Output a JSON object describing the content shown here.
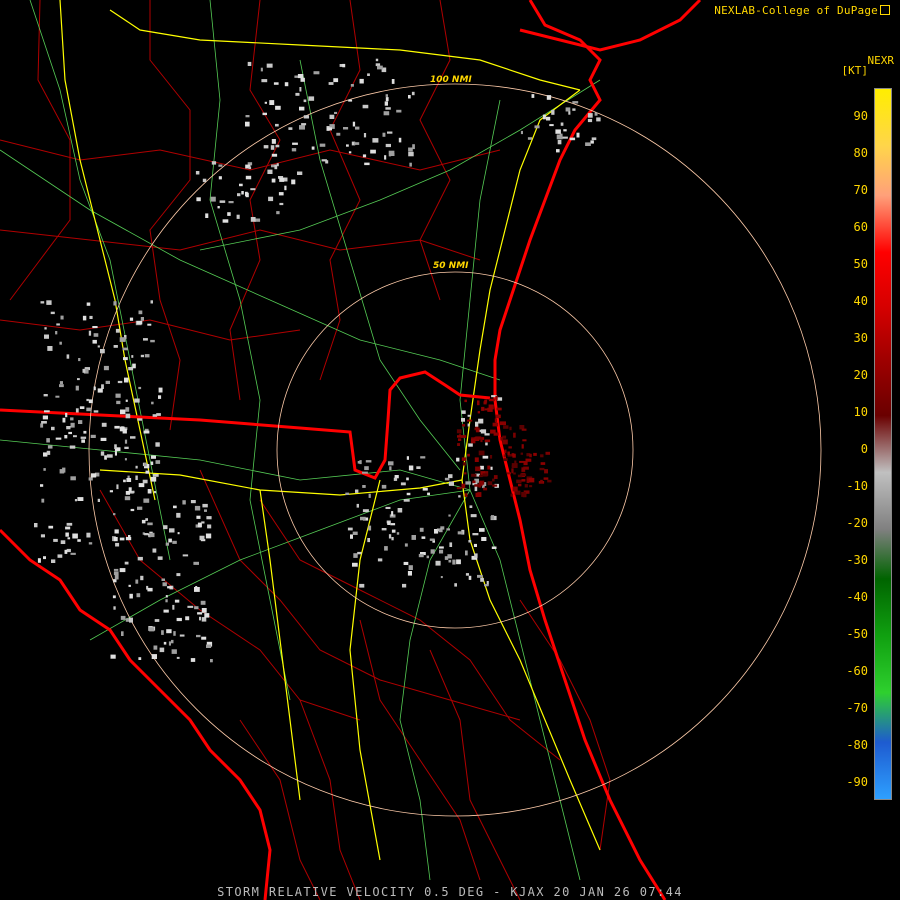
{
  "header": {
    "credit": "NEXLAB-College of DuPage",
    "product": "NEXR",
    "unit": "[KT]"
  },
  "footer": {
    "caption": "STORM RELATIVE VELOCITY 0.5 DEG - KJAX 20 JAN 26 07:44"
  },
  "range_rings": [
    {
      "label": "50 NMI",
      "range_nmi": 50
    },
    {
      "label": "100 NMI",
      "range_nmi": 100
    }
  ],
  "colorbar": {
    "ticks": [
      "90",
      "80",
      "70",
      "60",
      "50",
      "40",
      "30",
      "20",
      "10",
      "0",
      "-10",
      "-20",
      "-30",
      "-40",
      "-50",
      "-60",
      "-70",
      "-80",
      "-90"
    ],
    "gradient": [
      "#ffee00",
      "#ffd54a",
      "#ffa07a",
      "#ff0000",
      "#d40000",
      "#a00000",
      "#6a0000",
      "#c0c0c0",
      "#808080",
      "#006400",
      "#10a010",
      "#2ed02e",
      "#1e5bd0",
      "#2ea0ff"
    ]
  },
  "colors": {
    "coast": "#ff0000",
    "boundary": "#b00000",
    "interstate": "#ffff00",
    "highway": "#55cc55",
    "ring": "#ffccaa",
    "label": "#ffd700"
  }
}
